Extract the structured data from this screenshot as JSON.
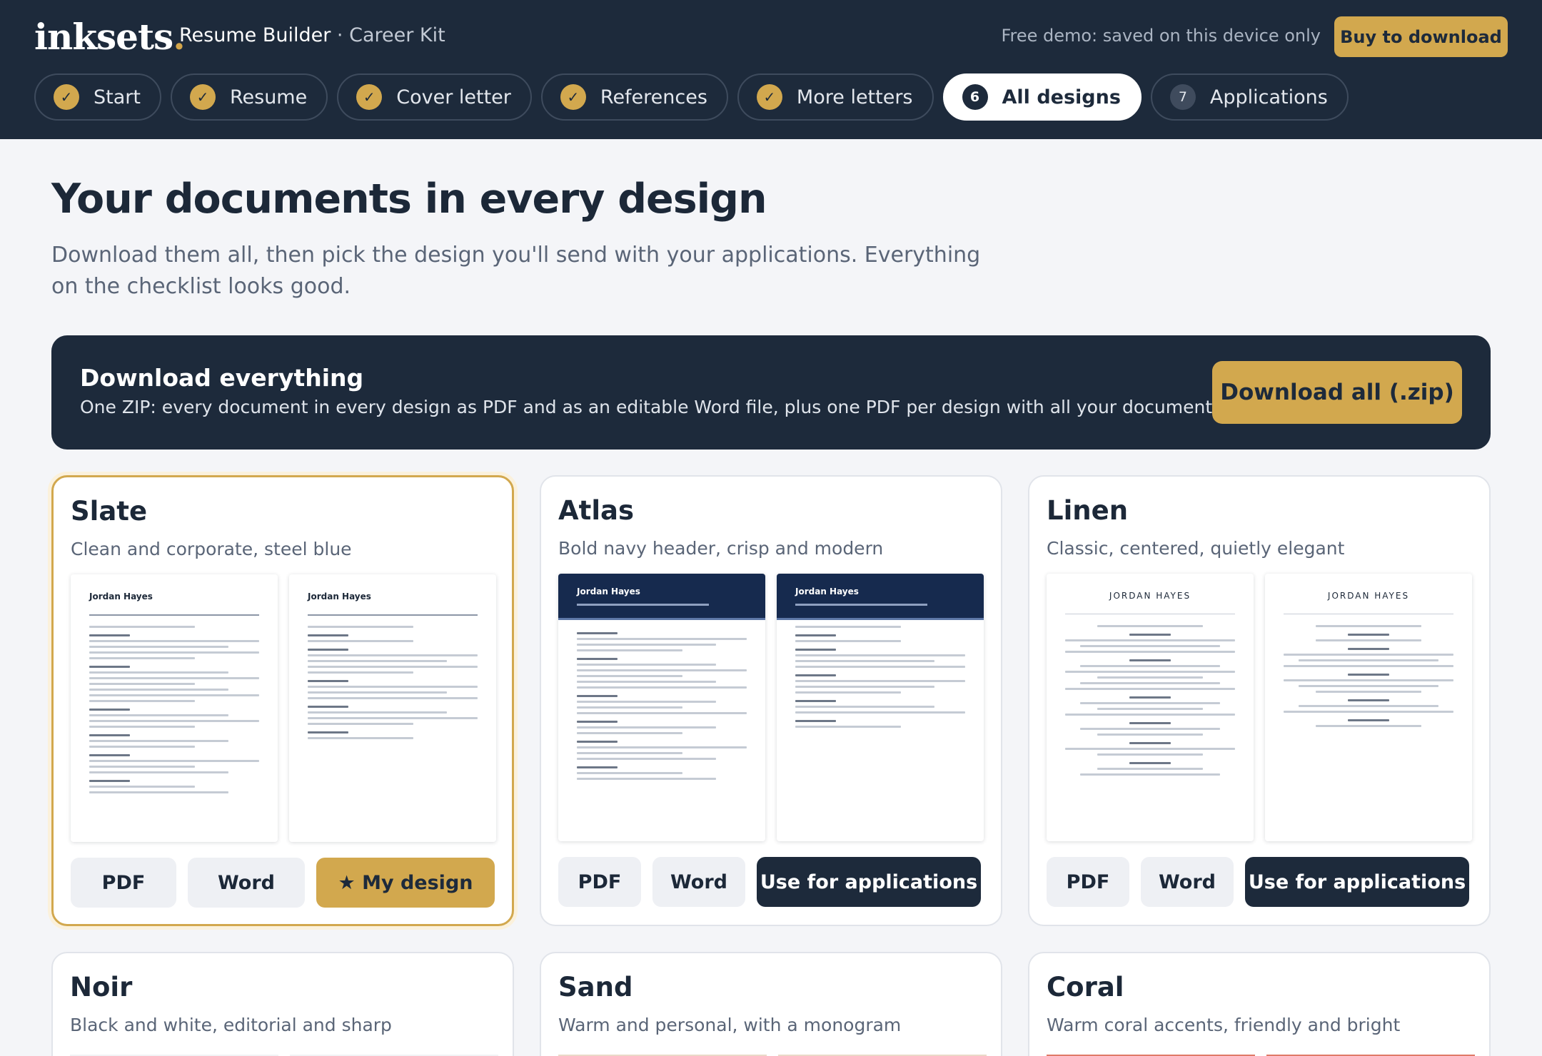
{
  "brand": {
    "logo": "inksets",
    "logo_dot": "."
  },
  "header": {
    "app_name": "Resume Builder",
    "separator": "·",
    "kit_name": "Career Kit",
    "demo_note": "Free demo: saved on this device only",
    "buy_label": "Buy to download"
  },
  "steps": [
    {
      "badge": "✓",
      "label": "Start",
      "state": "done"
    },
    {
      "badge": "✓",
      "label": "Resume",
      "state": "done"
    },
    {
      "badge": "✓",
      "label": "Cover letter",
      "state": "done"
    },
    {
      "badge": "✓",
      "label": "References",
      "state": "done"
    },
    {
      "badge": "✓",
      "label": "More letters",
      "state": "done"
    },
    {
      "badge": "6",
      "label": "All designs",
      "state": "active"
    },
    {
      "badge": "7",
      "label": "Applications",
      "state": "todo"
    }
  ],
  "main": {
    "title": "Your documents in every design",
    "subtitle": "Download them all, then pick the design you'll send with your applications. Everything on the checklist looks good."
  },
  "banner": {
    "title": "Download everything",
    "description": "One ZIP: every document in every design as PDF and as an editable Word file, plus one PDF per design with all your documents.",
    "button_label": "Download all (.zip)"
  },
  "preview": {
    "person_name": "Jordan Hayes",
    "person_name_caps": "JORDAN HAYES"
  },
  "designs": [
    {
      "name": "Slate",
      "description": "Clean and corporate, steel blue",
      "pdf_label": "PDF",
      "word_label": "Word",
      "action_label": "★ My design",
      "selected": true
    },
    {
      "name": "Atlas",
      "description": "Bold navy header, crisp and modern",
      "pdf_label": "PDF",
      "word_label": "Word",
      "action_label": "Use for applications",
      "selected": false
    },
    {
      "name": "Linen",
      "description": "Classic, centered, quietly elegant",
      "pdf_label": "PDF",
      "word_label": "Word",
      "action_label": "Use for applications",
      "selected": false
    },
    {
      "name": "Noir",
      "description": "Black and white, editorial and sharp"
    },
    {
      "name": "Sand",
      "description": "Warm and personal, with a monogram"
    },
    {
      "name": "Coral",
      "description": "Warm coral accents, friendly and bright"
    }
  ],
  "colors": {
    "navy": "#1d2a3b",
    "gold": "#d2a84e",
    "background": "#f4f5f8",
    "atlas_header": "#162a4e",
    "sand_accent": "#ead9c8",
    "coral_accent": "#e07a68"
  }
}
